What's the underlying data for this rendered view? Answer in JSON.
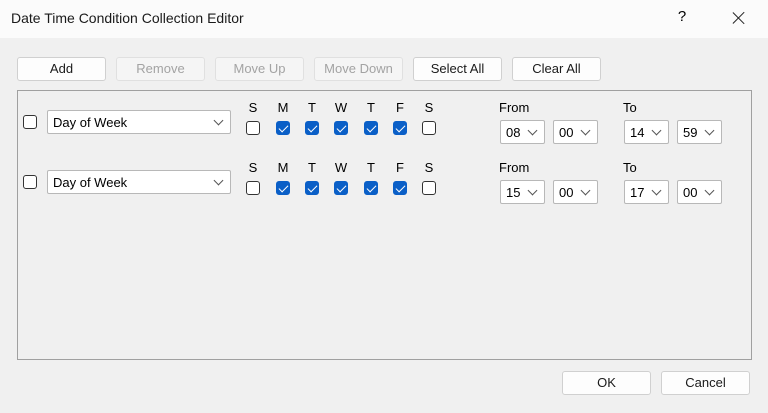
{
  "window": {
    "title": "Date Time Condition Collection Editor",
    "help_glyph": "?"
  },
  "toolbar": {
    "add": "Add",
    "remove": "Remove",
    "move_up": "Move Up",
    "move_down": "Move Down",
    "select_all": "Select All",
    "clear_all": "Clear All"
  },
  "day_labels": [
    "S",
    "M",
    "T",
    "W",
    "T",
    "F",
    "S"
  ],
  "from_label": "From",
  "to_label": "To",
  "rows": [
    {
      "selected": false,
      "condition_type": "Day of Week",
      "days": [
        false,
        true,
        true,
        true,
        true,
        true,
        false
      ],
      "from_hour": "08",
      "from_minute": "00",
      "to_hour": "14",
      "to_minute": "59"
    },
    {
      "selected": false,
      "condition_type": "Day of Week",
      "days": [
        false,
        true,
        true,
        true,
        true,
        true,
        false
      ],
      "from_hour": "15",
      "from_minute": "00",
      "to_hour": "17",
      "to_minute": "00"
    }
  ],
  "footer": {
    "ok": "OK",
    "cancel": "Cancel"
  },
  "colors": {
    "checkbox_checked": "#0a5fc7",
    "panel_border": "#a0a0a0"
  }
}
